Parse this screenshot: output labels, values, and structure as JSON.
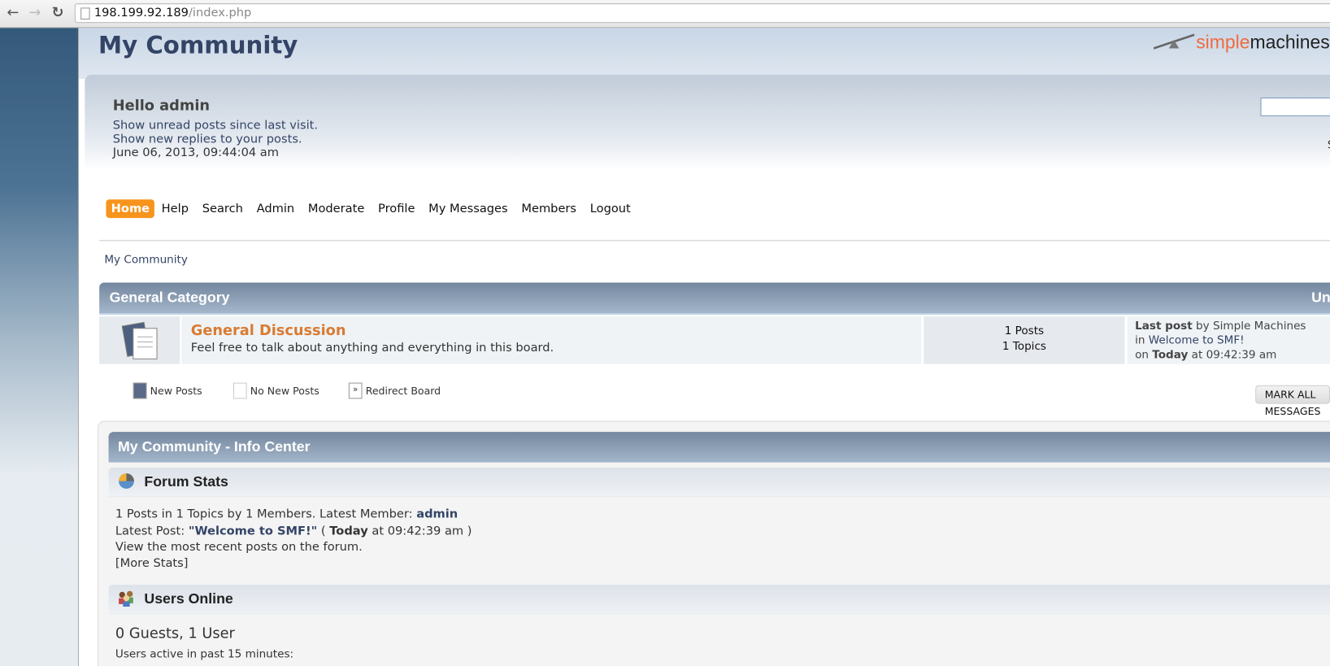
{
  "browser": {
    "url_host": "198.199.92.189",
    "url_path": "/index.php"
  },
  "header": {
    "forum_title": "My Community",
    "logo_part1": "simple",
    "logo_part2": "machines"
  },
  "user": {
    "greeting": "Hello admin",
    "unread_link": "Show unread posts since last visit.",
    "replies_link": "Show new replies to your posts.",
    "datetime": "June 06, 2013, 09:44:04 am",
    "search_hint": "S"
  },
  "nav": {
    "items": [
      "Home",
      "Help",
      "Search",
      "Admin",
      "Moderate",
      "Profile",
      "My Messages",
      "Members",
      "Logout"
    ],
    "active": "Home",
    "accent": "#f7941d"
  },
  "breadcrumb": "My Community",
  "category": {
    "title": "General Category",
    "right_label": "Un",
    "board": {
      "name": "General Discussion",
      "description": "Feel free to talk about anything and everything in this board.",
      "posts": "1 Posts",
      "topics": "1 Topics",
      "lastpost_label": "Last post",
      "lastpost_by": " by Simple Machines",
      "in_text": "in ",
      "topic": "Welcome to SMF!",
      "on_text": "on ",
      "today": "Today",
      "time": " at 09:42:39 am"
    }
  },
  "legend": {
    "new": "New Posts",
    "none": "No New Posts",
    "redirect": "Redirect Board"
  },
  "mark_all": "MARK ALL MESSAGES AS READ",
  "info_center": {
    "title": "My Community - Info Center",
    "stats_title": "Forum Stats",
    "stats_line1": "1 Posts in 1 Topics by 1 Members. Latest Member: ",
    "latest_member": "admin",
    "latest_post_label": "Latest Post: ",
    "latest_post": "\"Welcome to SMF!\"",
    "lp_open": " ( ",
    "lp_today": "Today",
    "lp_time": " at 09:42:39 am )",
    "recent_link": "View the most recent posts on the forum.",
    "more_stats": "[More Stats]",
    "online_title": "Users Online",
    "online_count": "0 Guests, 1 User",
    "active_text": "Users active in past 15 minutes:"
  }
}
